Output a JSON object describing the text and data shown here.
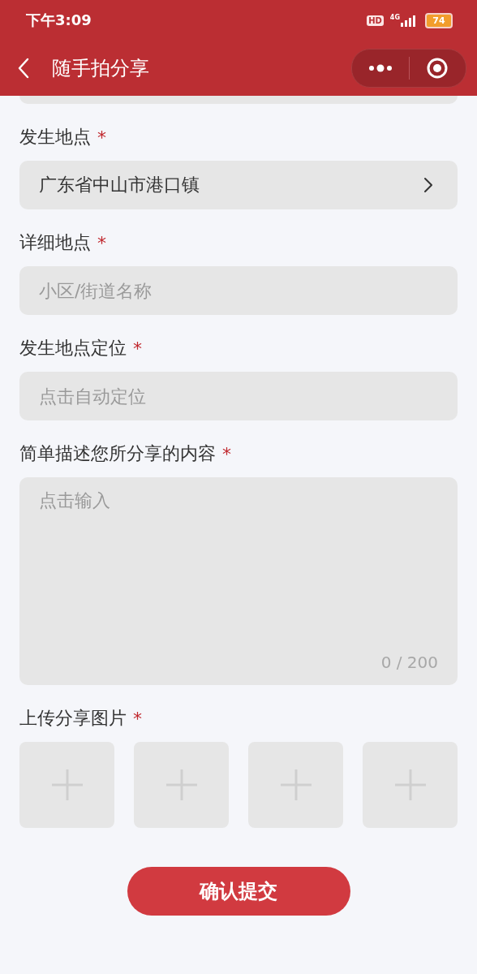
{
  "status_bar": {
    "time": "下午3:09",
    "hd": "HD",
    "network": "4G",
    "battery": "74"
  },
  "header": {
    "title": "随手拍分享"
  },
  "fields": [
    {
      "kind": "select",
      "label": "发生地点",
      "required_mark": "*",
      "value": "广东省中山市港口镇"
    },
    {
      "kind": "input",
      "label": "详细地点",
      "required_mark": "*",
      "placeholder": "小区/街道名称"
    },
    {
      "kind": "input",
      "label": "发生地点定位",
      "required_mark": "*",
      "placeholder": "点击自动定位"
    },
    {
      "kind": "textarea",
      "label": "简单描述您所分享的内容",
      "required_mark": "*",
      "placeholder": "点击输入",
      "counter": "0 / 200"
    }
  ],
  "upload": {
    "label": "上传分享图片",
    "required_mark": "*",
    "slots": [
      {
        "kind": "add"
      },
      {
        "kind": "add"
      },
      {
        "kind": "add"
      },
      {
        "kind": "add"
      }
    ]
  },
  "submit": {
    "label": "确认提交"
  }
}
